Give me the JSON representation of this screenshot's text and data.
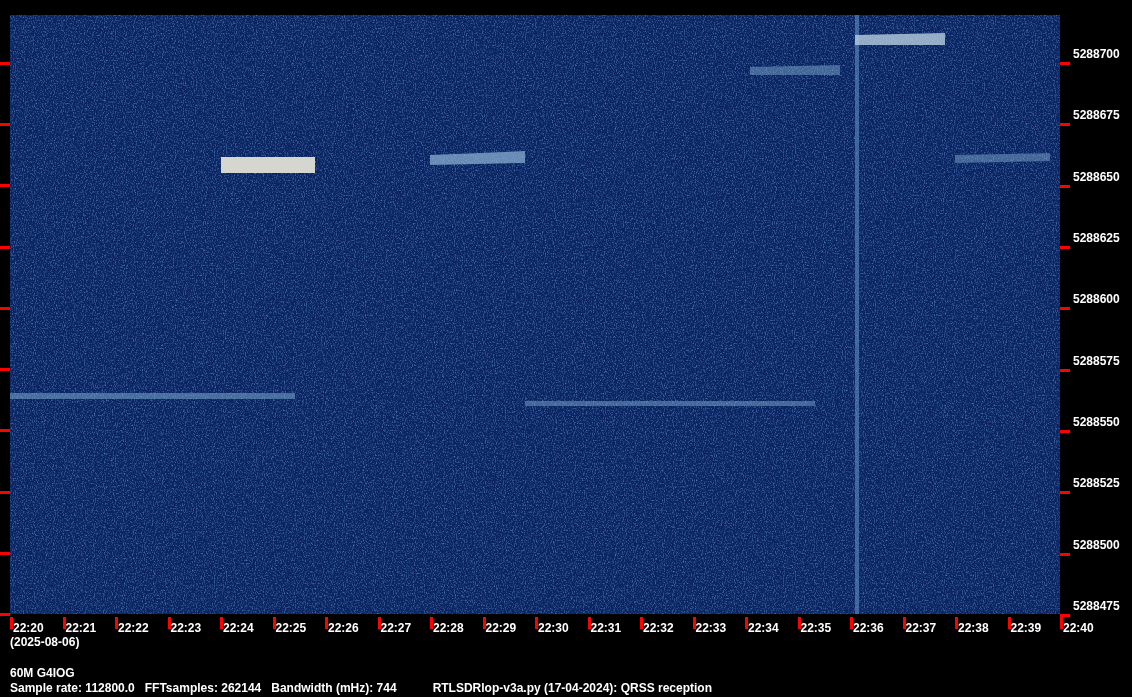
{
  "frequency_axis": {
    "labels": [
      "5288700",
      "5288675",
      "5288650",
      "5288625",
      "5288600",
      "5288575",
      "5288550",
      "5288525",
      "5288500",
      "5288475"
    ]
  },
  "time_axis": {
    "labels": [
      "22:20",
      "22:21",
      "22:22",
      "22:23",
      "22:24",
      "22:25",
      "22:26",
      "22:27",
      "22:28",
      "22:29",
      "22:30",
      "22:31",
      "22:32",
      "22:33",
      "22:34",
      "22:35",
      "22:36",
      "22:37",
      "22:38",
      "22:39",
      "22:40"
    ],
    "date": "(2025-08-06)"
  },
  "station": "60M G4IOG",
  "info": [
    "Sample rate: 112800.0",
    "FFTsamples: 262144",
    "Bandwidth (mHz): 744",
    "RTLSDRlop-v3a.py (17-04-2024): QRSS reception"
  ]
}
